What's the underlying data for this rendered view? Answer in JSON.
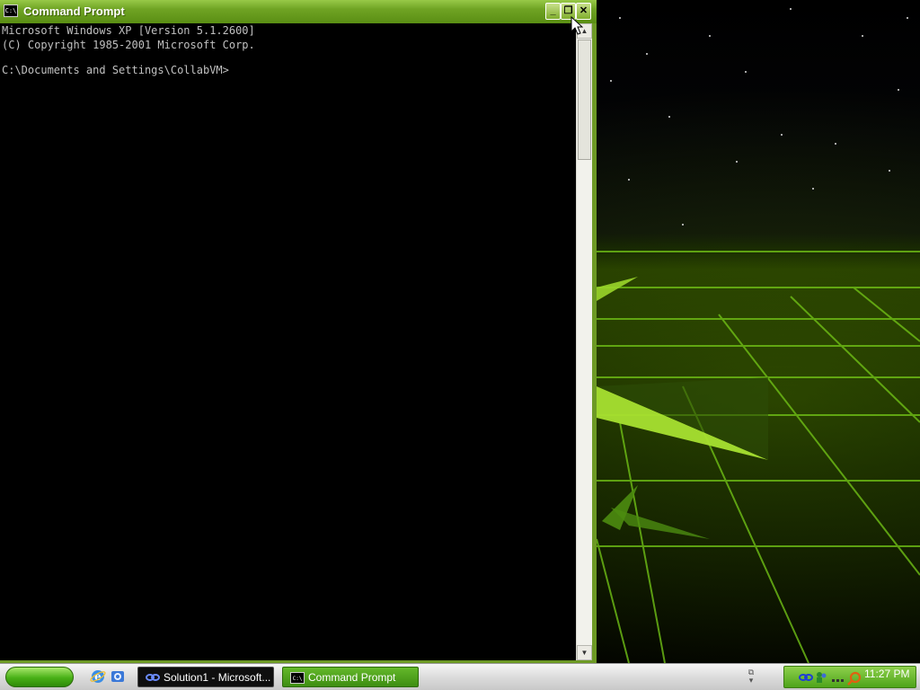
{
  "window": {
    "title": "Command Prompt",
    "icon": "cmd-icon",
    "icon_label": "C:\\",
    "buttons": {
      "minimize": "_",
      "restore": "❐",
      "close": "✕"
    }
  },
  "console": {
    "line1": "Microsoft Windows XP [Version 5.1.2600]",
    "line2": "(C) Copyright 1985-2001 Microsoft Corp.",
    "prompt": "C:\\Documents and Settings\\CollabVM>"
  },
  "taskbar": {
    "start_icon": "start-button",
    "quick_launch": [
      "internet-explorer-icon",
      "outlook-express-icon"
    ],
    "tasks": [
      {
        "label": "Solution1 - Microsoft...",
        "icon": "solution-icon",
        "active": false
      },
      {
        "label": "Command Prompt",
        "icon": "cmd-icon",
        "active": true
      }
    ],
    "tray": {
      "icons": [
        "network-icon",
        "people-icon",
        "dots-icon",
        "search-icon"
      ],
      "clock": "11:27 PM"
    }
  },
  "colors": {
    "titlebar": "#6fa323",
    "taskbar_active": "#3e8e12",
    "console_bg": "#000000",
    "console_fg": "#c0c0c0"
  }
}
